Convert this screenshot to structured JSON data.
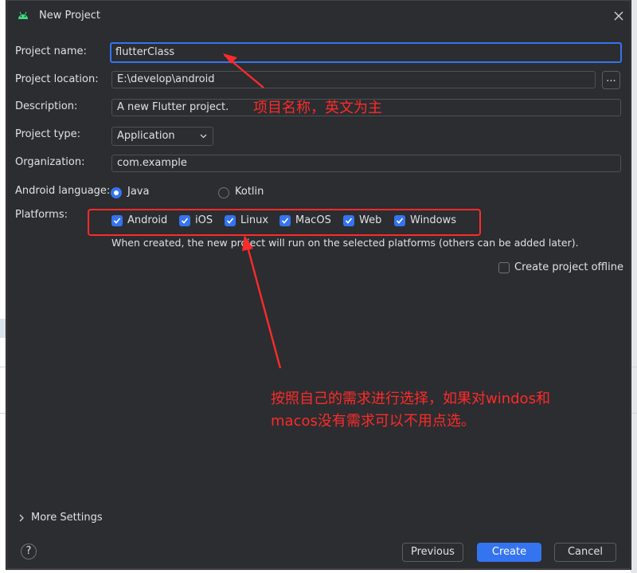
{
  "dialog": {
    "title": "New Project",
    "project_name": {
      "label": "Project name:",
      "value": "flutterClass"
    },
    "project_location": {
      "label": "Project location:",
      "value": "E:\\develop\\android",
      "browse_label": "..."
    },
    "description": {
      "label": "Description:",
      "value": "A new Flutter project."
    },
    "project_type": {
      "label": "Project type:",
      "value": "Application"
    },
    "organization": {
      "label": "Organization:",
      "value": "com.example"
    },
    "android_language": {
      "label": "Android language:",
      "options": [
        {
          "label": "Java",
          "selected": true
        },
        {
          "label": "Kotlin",
          "selected": false
        }
      ]
    },
    "platforms": {
      "label": "Platforms:",
      "items": [
        {
          "label": "Android",
          "checked": true
        },
        {
          "label": "iOS",
          "checked": true
        },
        {
          "label": "Linux",
          "checked": true
        },
        {
          "label": "MacOS",
          "checked": true
        },
        {
          "label": "Web",
          "checked": true
        },
        {
          "label": "Windows",
          "checked": true
        }
      ],
      "note": "When created, the new project will run on the selected platforms (others can be added later)."
    },
    "offline": {
      "label": "Create project offline",
      "checked": false
    },
    "more_settings": "More Settings",
    "buttons": {
      "help": "?",
      "previous": "Previous",
      "create": "Create",
      "cancel": "Cancel"
    }
  },
  "annotations": {
    "name_note": "项目名称，英文为主",
    "platform_note_line1": "按照自己的需求进行选择，如果对windos和",
    "platform_note_line2": "macos没有需求可以不用点选。",
    "color": "#ff2a2a"
  },
  "colors": {
    "accent": "#3574f0",
    "dialog_bg": "#2b2d30",
    "annotation": "#ff2a2a"
  }
}
